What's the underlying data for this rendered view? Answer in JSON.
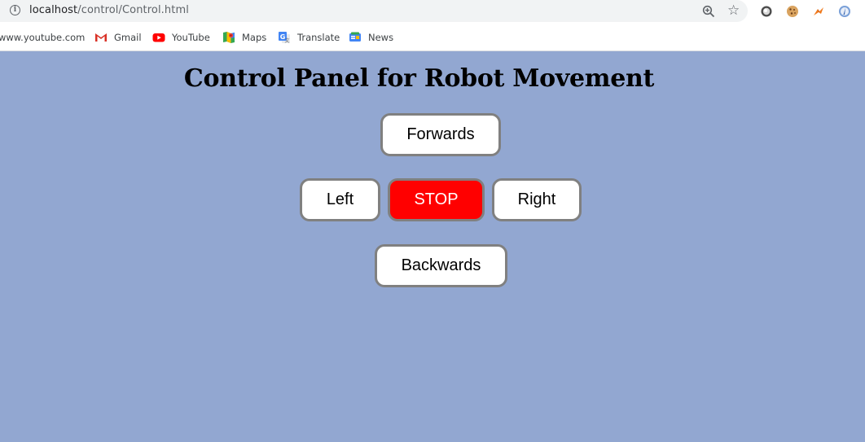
{
  "browser": {
    "url_host": "localhost",
    "url_path": "/control/Control.html",
    "icons": {
      "info": "info-icon",
      "zoom": "zoom-in-icon",
      "bookmark_star": "star-icon",
      "extensions": [
        "grey-circle-extension-icon",
        "cookie-extension-icon",
        "fox-extension-icon",
        "blue-circle-extension-icon"
      ]
    }
  },
  "bookmarks": {
    "items": [
      {
        "label": "www.youtube.com",
        "icon": "none"
      },
      {
        "label": "Gmail",
        "icon": "gmail-icon"
      },
      {
        "label": "YouTube",
        "icon": "youtube-icon"
      },
      {
        "label": "Maps",
        "icon": "maps-icon"
      },
      {
        "label": "Translate",
        "icon": "translate-icon"
      },
      {
        "label": "News",
        "icon": "news-icon"
      }
    ]
  },
  "page": {
    "background_color": "#92a7d1",
    "title": "Control Panel for Robot Movement",
    "buttons": {
      "forwards": "Forwards",
      "left": "Left",
      "stop": "STOP",
      "right": "Right",
      "backwards": "Backwards"
    },
    "stop_color": "#ff0000"
  }
}
